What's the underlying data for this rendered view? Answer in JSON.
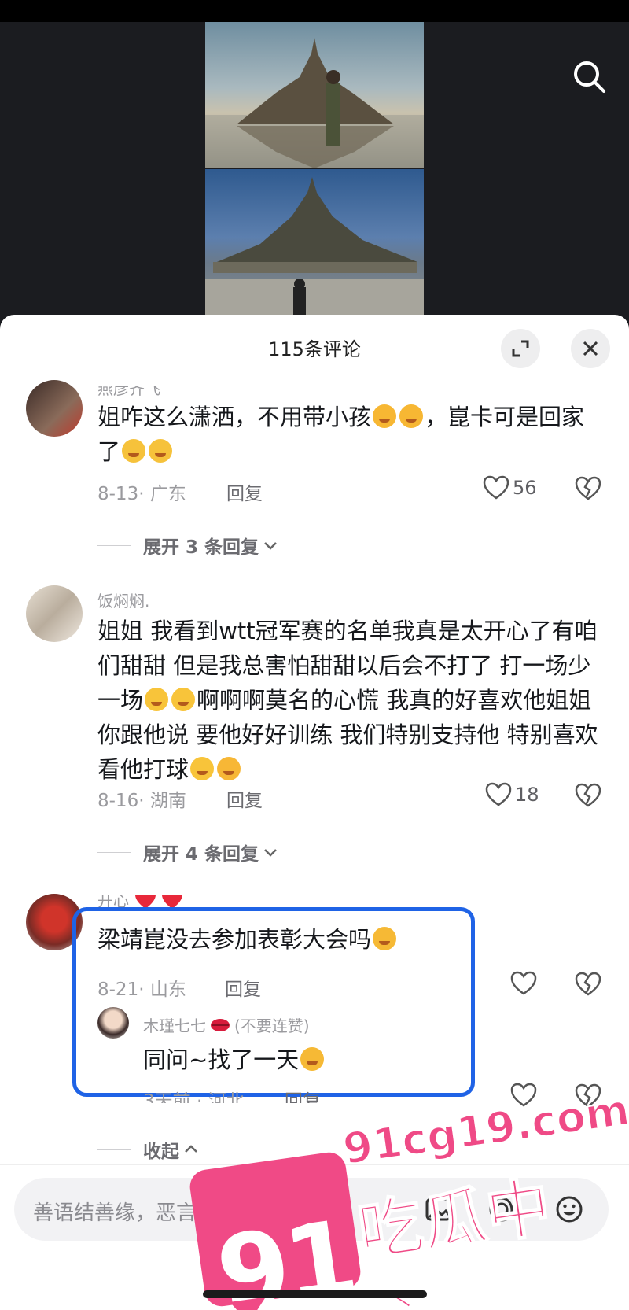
{
  "header": {
    "title": "115条评论"
  },
  "comments": [
    {
      "username": "燕彦齐飞",
      "text_a": "姐咋这么潇洒，不用带小孩",
      "text_b": "，崑卡可是回家了",
      "date_loc": "8-13· 广东",
      "reply": "回复",
      "likes": "56",
      "expand": "展开 3 条回复"
    },
    {
      "username": "饭焖焖.",
      "text_a": "姐姐 我看到wtt冠军赛的名单我真是太开心了有咱们甜甜 但是我总害怕甜甜以后会不打了 打一场少一场",
      "text_b": "啊啊啊莫名的心慌 我真的好喜欢他姐姐你跟他说 要他好好训练 我们特别支持他 特别喜欢看他打球",
      "date_loc": "8-16· 湖南",
      "reply": "回复",
      "likes": "18",
      "expand": "展开 4 条回复"
    },
    {
      "username": "开心",
      "text_a": "梁靖崑没去参加表彰大会吗",
      "date_loc": "8-21· 山东",
      "reply": "回复",
      "collapse": "收起",
      "sub_reply": {
        "username": "木瑾七七",
        "badge": "(不要连赞)",
        "text": "同问~找了一天",
        "date_loc": "3天前 · 河北",
        "reply": "回复"
      }
    }
  ],
  "input": {
    "placeholder": "善语结善缘，恶言伤人心"
  },
  "watermark": {
    "number": "91",
    "site": "91cg19.com",
    "name": "吃瓜中心"
  },
  "icons": [
    "search-icon",
    "expand-icon",
    "close-icon",
    "heart-icon",
    "broken-heart-icon",
    "chevron-down-icon",
    "chevron-up-icon",
    "image-icon",
    "at-icon",
    "emoji-icon"
  ],
  "colors": {
    "highlight": "#1f63e6",
    "watermark": "#ef4a86",
    "sheet": "#ffffff",
    "backdrop": "#1b1c20"
  }
}
